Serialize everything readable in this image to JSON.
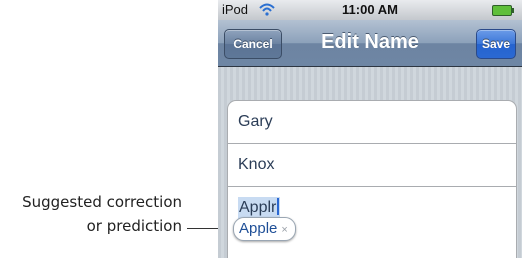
{
  "annotation": {
    "line1": "Suggested correction",
    "line2": "or prediction"
  },
  "status_bar": {
    "carrier": "iPod",
    "wifi_icon": "wifi-icon",
    "time": "11:00 AM",
    "battery_icon": "battery-charging-icon"
  },
  "nav": {
    "title": "Edit Name",
    "cancel_label": "Cancel",
    "save_label": "Save"
  },
  "fields": {
    "first_name": "Gary",
    "last_name": "Knox",
    "company_typed": "Applr"
  },
  "suggestion": {
    "text": "Apple",
    "dismiss_glyph": "×"
  },
  "colors": {
    "nav_bar": "#6e86a4",
    "save_button": "#2b69d2",
    "background": "#cbd2d8",
    "field_text": "#2b3d57",
    "suggestion_text": "#1f4f97"
  }
}
